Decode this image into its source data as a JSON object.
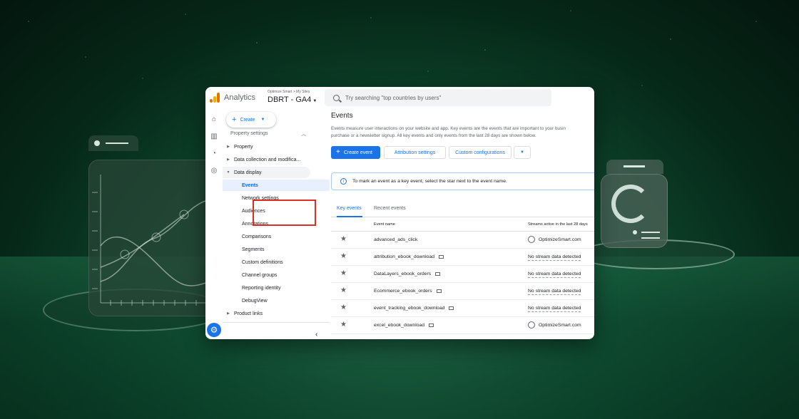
{
  "app": {
    "name": "Analytics",
    "account_path": "Optimize Smart > My Sites",
    "property": "DBRT - GA4",
    "search_placeholder": "Try searching \"top countries by users\""
  },
  "nav": {
    "create_label": "Create",
    "section_title": "Property settings",
    "items": [
      {
        "label": "Property",
        "level": 0
      },
      {
        "label": "Data collection and modifica...",
        "level": 0
      },
      {
        "label": "Data display",
        "level": 0
      },
      {
        "label": "Events",
        "level": 1
      },
      {
        "label": "Network settings",
        "level": 1
      },
      {
        "label": "Audiences",
        "level": 1
      },
      {
        "label": "Annotations",
        "level": 1
      },
      {
        "label": "Comparisons",
        "level": 1
      },
      {
        "label": "Segments",
        "level": 1
      },
      {
        "label": "Custom definitions",
        "level": 1
      },
      {
        "label": "Channel groups",
        "level": 1
      },
      {
        "label": "Reporting identity",
        "level": 1
      },
      {
        "label": "DebugView",
        "level": 1
      },
      {
        "label": "Product links",
        "level": 0
      }
    ]
  },
  "main": {
    "title": "Events",
    "description_line1": "Events measure user interactions on your website and app. Key events are the events that are important to your busin",
    "description_line2": "purchase or a newsletter signup. All key events and only events from the last 28 days are shown below.",
    "buttons": {
      "create_event": "Create event",
      "attribution_settings": "Attribution settings",
      "custom_configurations": "Custom configurations"
    },
    "banner": "To mark an event as a key event, select the star next to the event name.",
    "tabs": [
      "Key events",
      "Recent events"
    ],
    "columns": [
      "Event name",
      "Streams active in the last 28 days"
    ],
    "rows": [
      {
        "name": "advanced_ads_click",
        "stream": "OptimizeSmart.com"
      },
      {
        "name": "attribution_ebook_download",
        "stream": "No stream data detected"
      },
      {
        "name": "DataLayers_ebook_orders",
        "stream": "No stream data detected"
      },
      {
        "name": "Ecommerce_ebook_orders",
        "stream": "No stream data detected"
      },
      {
        "name": "event_tracking_ebook_download",
        "stream": "No stream data detected"
      },
      {
        "name": "excel_ebook_download",
        "stream": "OptimizeSmart.com"
      }
    ]
  },
  "colors": {
    "accent": "#1a73e8",
    "highlight_box": "#d93025",
    "background": "#0f4d31"
  }
}
